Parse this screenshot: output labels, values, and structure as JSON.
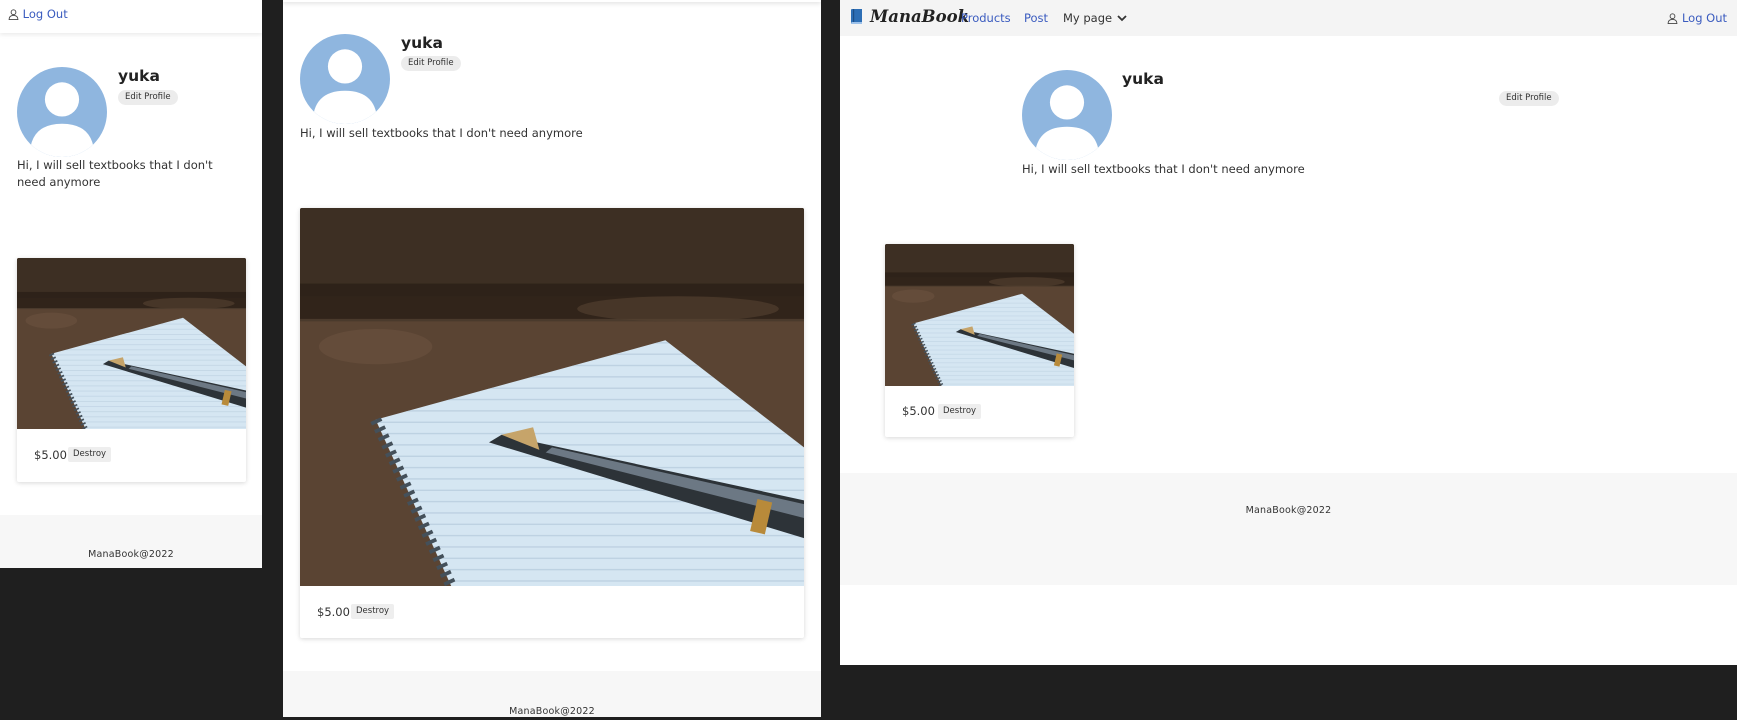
{
  "brand": {
    "name": "ManaBook",
    "logo_icon": "book-icon",
    "logo_color": "#2d6eb5"
  },
  "nav": {
    "products": "Products",
    "post": "Post",
    "my_page": "My page",
    "logout": "Log Out",
    "link_color": "#3a5bbf"
  },
  "profile": {
    "username": "yuka",
    "edit_button": "Edit Profile",
    "bio": "Hi, I will sell textbooks that I don't need anymore",
    "avatar_icon": "default-avatar-icon",
    "avatar_color": "#8fb6df"
  },
  "products": [
    {
      "price": "$5.00",
      "destroy_label": "Destroy",
      "image": "notebook-with-fountain-pen"
    }
  ],
  "footer": {
    "text": "ManaBook@2022"
  }
}
